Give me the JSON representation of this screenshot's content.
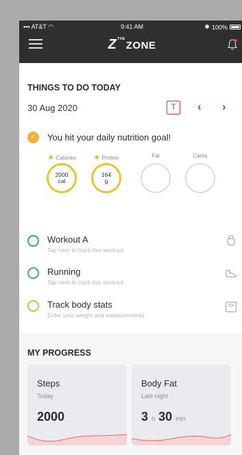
{
  "status": {
    "carrier": "AT&T",
    "time": "9:41 AM",
    "battery": "100%"
  },
  "header": {
    "logo_the": "THE",
    "logo_text": "ZONE"
  },
  "todo": {
    "title": "THINGS TO DO TODAY",
    "date": "30 Aug 2020",
    "today_button": "T",
    "prev": "‹",
    "next": "›",
    "goal_text": "You hit your daily nutrition goal!",
    "check": "✓",
    "nutrition": [
      {
        "label": "Calories",
        "starred": true,
        "value": "2000",
        "unit": "cal"
      },
      {
        "label": "Protein",
        "starred": true,
        "value": "164",
        "unit": "g"
      },
      {
        "label": "Fat",
        "starred": false,
        "value": "",
        "unit": ""
      },
      {
        "label": "Carbs",
        "starred": false,
        "value": "",
        "unit": ""
      }
    ],
    "tasks": [
      {
        "name": "Workout A",
        "sub": "Tap here to track this workout",
        "color": "#2d9ad6",
        "icon": "kettlebell-icon"
      },
      {
        "name": "Running",
        "sub": "Tap here to track this workout",
        "color": "#3ab56a",
        "icon": "shoe-icon"
      },
      {
        "name": "Track body stats",
        "sub": "Enter your weight and measurements",
        "color": "#f0b230",
        "icon": "scale-icon"
      }
    ]
  },
  "progress": {
    "title": "MY PROGRESS",
    "cards": [
      {
        "title": "Steps",
        "sub": "Today",
        "value": "2000"
      },
      {
        "title": "Body Fat",
        "sub": "Last night",
        "hours": "3",
        "h_unit": "h",
        "minutes": "30",
        "m_unit": "min"
      }
    ]
  },
  "colors": {
    "accent": "#d93a3a",
    "gold": "#f0b230",
    "header_bg": "#2f2f2f"
  }
}
